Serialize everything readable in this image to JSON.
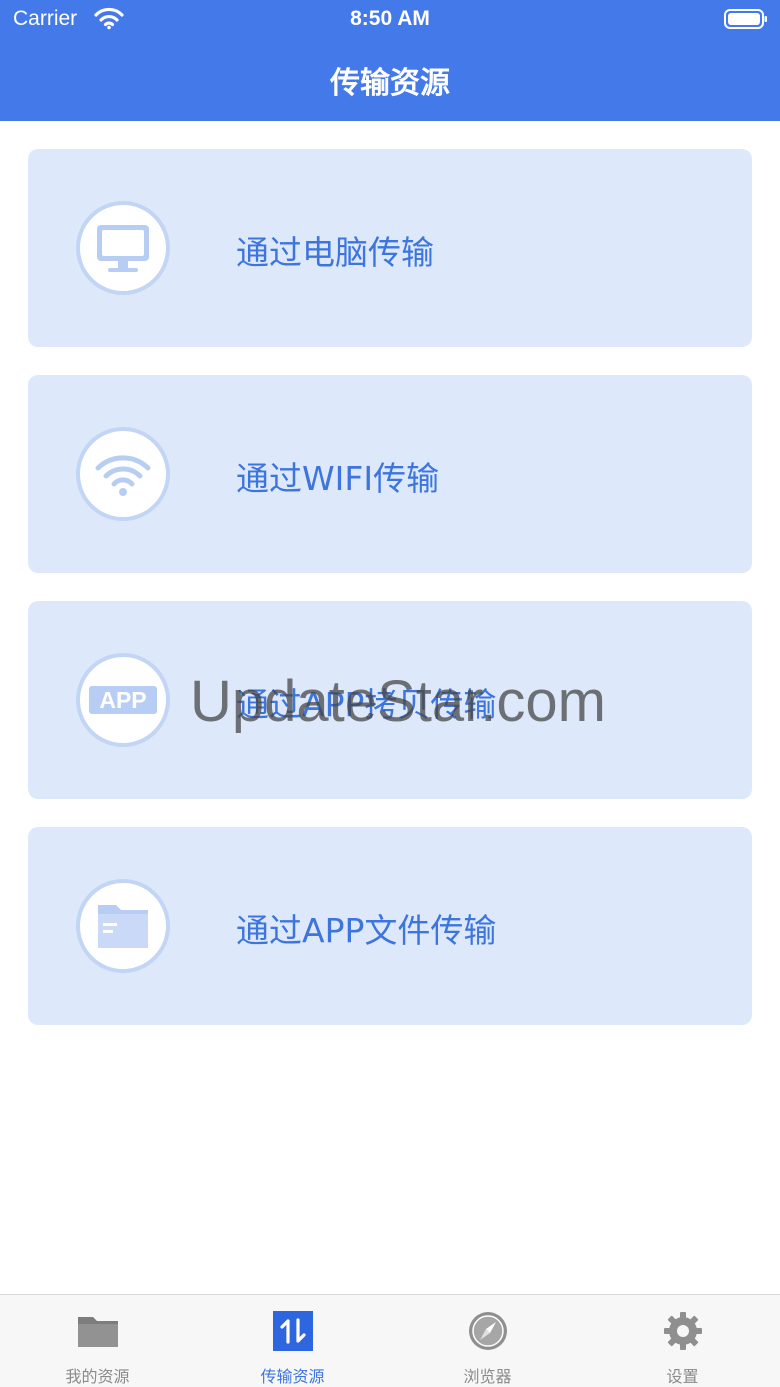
{
  "status_bar": {
    "carrier": "Carrier",
    "time": "8:50 AM"
  },
  "nav": {
    "title": "传输资源"
  },
  "options": [
    {
      "label": "通过电脑传输",
      "icon": "monitor-icon"
    },
    {
      "label": "通过WIFI传输",
      "icon": "wifi-icon"
    },
    {
      "label": "通过APP拷贝传输",
      "icon": "app-icon",
      "icon_text": "APP"
    },
    {
      "label": "通过APP文件传输",
      "icon": "folder-icon"
    }
  ],
  "watermark": "UpdateStar.com",
  "tabs": [
    {
      "label": "我的资源",
      "icon": "folder-tab-icon"
    },
    {
      "label": "传输资源",
      "icon": "transfer-icon",
      "active": true
    },
    {
      "label": "浏览器",
      "icon": "compass-icon"
    },
    {
      "label": "设置",
      "icon": "gear-icon"
    }
  ],
  "colors": {
    "accent": "#4479ea",
    "card_bg": "#dde9fb",
    "label": "#3d75dc"
  }
}
